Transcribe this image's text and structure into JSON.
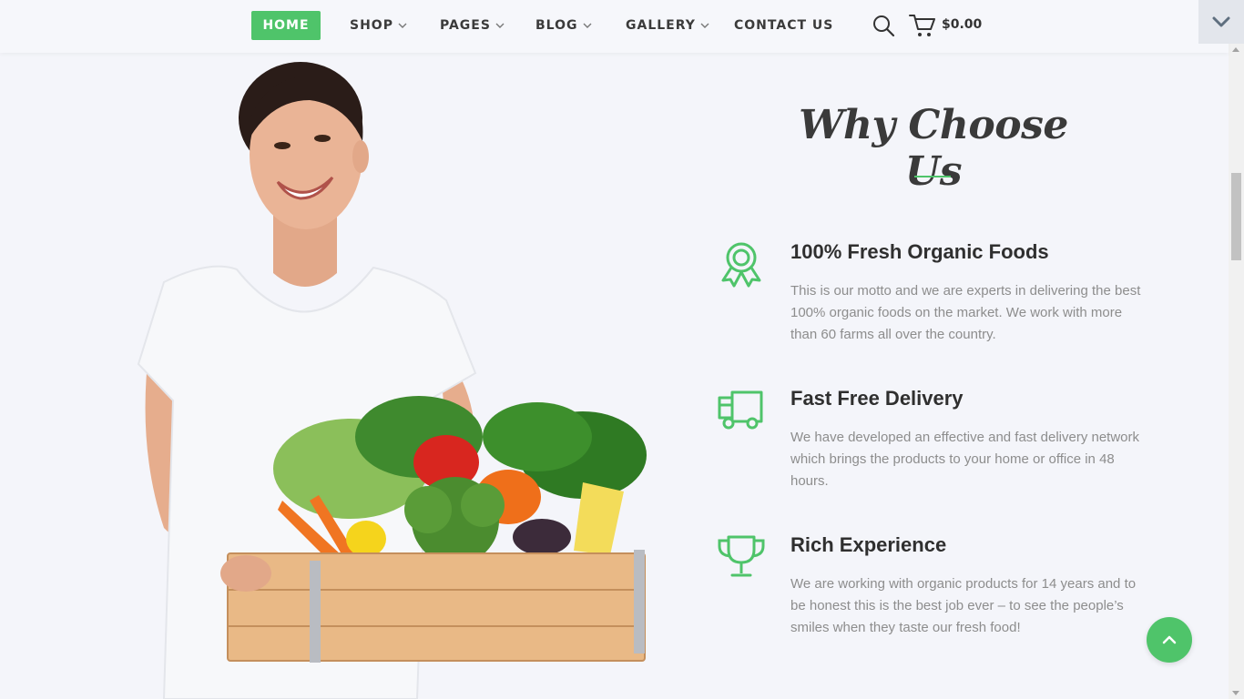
{
  "nav": {
    "items": [
      {
        "label": "HOME",
        "dropdown": false,
        "active": true
      },
      {
        "label": "SHOP",
        "dropdown": true
      },
      {
        "label": "PAGES",
        "dropdown": true
      },
      {
        "label": "BLOG",
        "dropdown": true
      },
      {
        "label": "GALLERY",
        "dropdown": true
      },
      {
        "label": "CONTACT US",
        "dropdown": false
      }
    ],
    "cart_total": "$0.00",
    "icons": [
      "search-icon",
      "cart-icon",
      "chevron-down-icon"
    ]
  },
  "section": {
    "title": "Why Choose Us",
    "features": [
      {
        "icon": "award-ribbon-icon",
        "title": "100% Fresh Organic Foods",
        "text": "This is our motto and we are experts in delivering the best 100% organic foods on the market. We work with more than 60 farms all over the country."
      },
      {
        "icon": "delivery-truck-icon",
        "title": "Fast Free Delivery",
        "text": "We have developed an effective and fast delivery network which brings the products to your home or office in 48 hours."
      },
      {
        "icon": "trophy-icon",
        "title": "Rich Experience",
        "text": "We are working with organic products for 14 years and to be honest this is the best job ever – to see the people’s smiles when they taste our fresh food!"
      }
    ]
  },
  "colors": {
    "accent": "#4fc46a",
    "background": "#f4f5fa",
    "heading": "#2f2f2f",
    "body_text": "#8d8d8d"
  }
}
